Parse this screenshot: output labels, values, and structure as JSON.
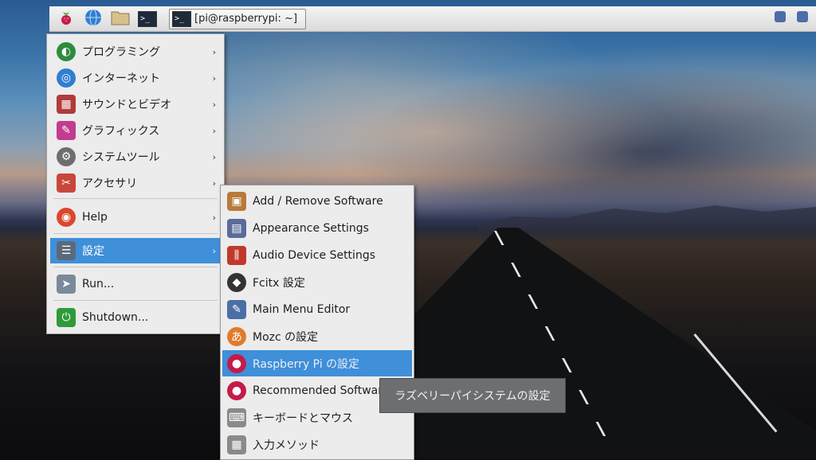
{
  "panel": {
    "task_label": "[pi@raspberrypi: ~]",
    "icons": [
      "raspberry-icon",
      "globe-icon",
      "folder-icon",
      "terminal-icon"
    ]
  },
  "menu": {
    "items": [
      {
        "label": "プログラミング",
        "icon": "programming-icon",
        "color": "#2e8b3c"
      },
      {
        "label": "インターネット",
        "icon": "globe-icon",
        "color": "#2f7ed0"
      },
      {
        "label": "サウンドとビデオ",
        "icon": "sound-video-icon",
        "color": "#b23a3a"
      },
      {
        "label": "グラフィックス",
        "icon": "graphics-icon",
        "color": "#c23d8f"
      },
      {
        "label": "システムツール",
        "icon": "gear-icon",
        "color": "#6e6e6e"
      },
      {
        "label": "アクセサリ",
        "icon": "accessories-icon",
        "color": "#c9473a"
      },
      {
        "label": "Help",
        "icon": "lifebuoy-icon",
        "color": "#d9482f"
      },
      {
        "label": "設定",
        "icon": "settings-icon",
        "color": "#5b6a7a"
      },
      {
        "label": "Run...",
        "icon": "paper-plane-icon",
        "color": "#7a8a9a"
      },
      {
        "label": "Shutdown...",
        "icon": "shutdown-icon",
        "color": "#2f9a3a"
      }
    ],
    "selected": "設定"
  },
  "submenu": {
    "items": [
      {
        "label": "Add / Remove Software",
        "icon": "package-icon",
        "color": "#b87a3a"
      },
      {
        "label": "Appearance Settings",
        "icon": "appearance-icon",
        "color": "#5a6c9a"
      },
      {
        "label": "Audio Device Settings",
        "icon": "audio-mixer-icon",
        "color": "#c0392b"
      },
      {
        "label": "Fcitx 設定",
        "icon": "penguin-icon",
        "color": "#333333"
      },
      {
        "label": "Main Menu Editor",
        "icon": "menu-editor-icon",
        "color": "#4a6fa5"
      },
      {
        "label": "Mozc の設定",
        "icon": "mozc-icon",
        "color": "#e07b2a"
      },
      {
        "label": "Raspberry Pi の設定",
        "icon": "raspberry-icon",
        "color": "#c51a4a"
      },
      {
        "label": "Recommended Software",
        "icon": "raspberry-icon",
        "color": "#c51a4a"
      },
      {
        "label": "キーボードとマウス",
        "icon": "keyboard-icon",
        "color": "#8a8a8a"
      },
      {
        "label": "入力メソッド",
        "icon": "input-method-icon",
        "color": "#8a8a8a"
      }
    ],
    "selected": "Raspberry Pi の設定"
  },
  "tooltip": "ラズベリーパイシステムの設定",
  "colors": {
    "selection": "#3f8fd9",
    "menu_bg": "#ececec"
  }
}
